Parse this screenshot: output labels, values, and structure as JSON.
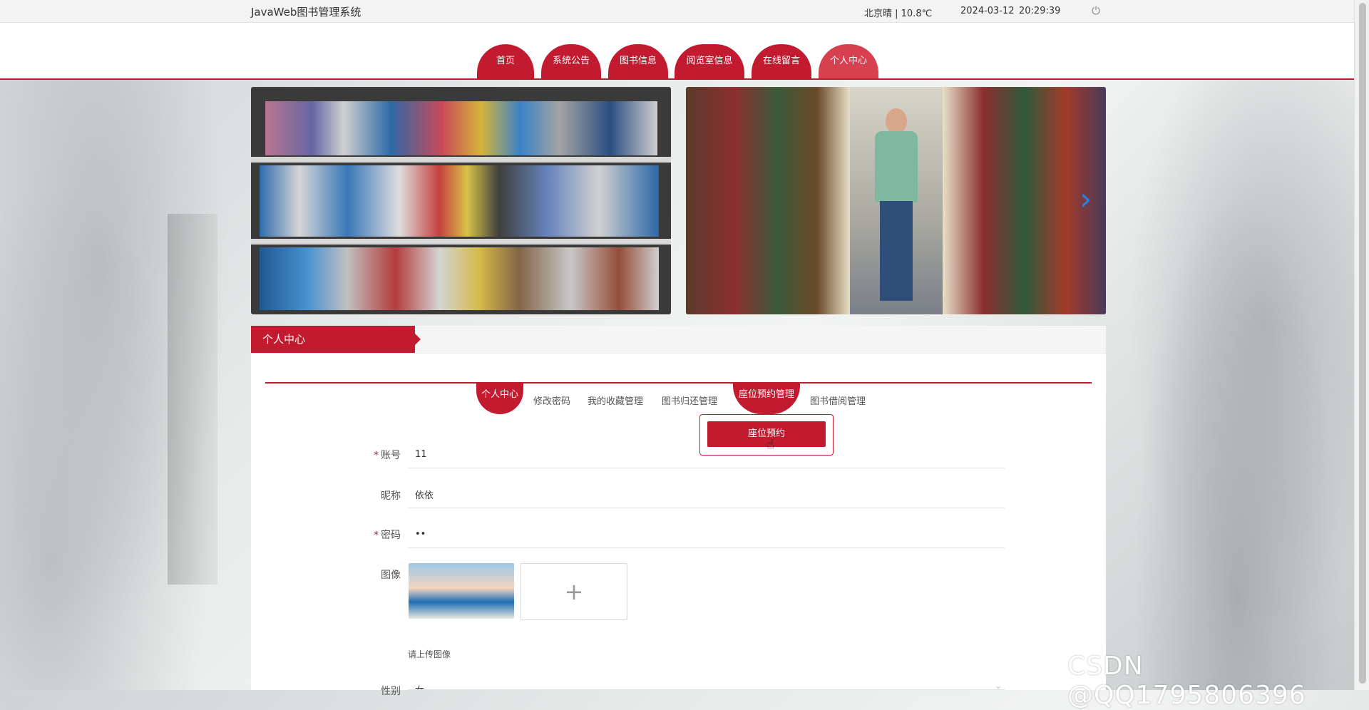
{
  "topbar": {
    "site_title": "JavaWeb图书管理系统",
    "weather": "北京晴 | 10.8℃",
    "date": "2024-03-12",
    "time": "20:29:39",
    "power_icon": "power-icon"
  },
  "nav": {
    "items": [
      {
        "label": "首页"
      },
      {
        "label": "系统公告"
      },
      {
        "label": "图书信息"
      },
      {
        "label": "阅览室信息"
      },
      {
        "label": "在线留言"
      },
      {
        "label": "个人中心"
      }
    ],
    "active": "个人中心"
  },
  "carousel": {
    "next_icon": "chevron-right-icon"
  },
  "panel": {
    "title": "个人中心",
    "sub_tabs": [
      {
        "label": "个人中心"
      },
      {
        "label": "修改密码"
      },
      {
        "label": "我的收藏管理"
      },
      {
        "label": "图书归还管理"
      },
      {
        "label": "座位预约管理"
      },
      {
        "label": "图书借阅管理"
      }
    ],
    "dropdown": {
      "item": "座位预约"
    }
  },
  "form": {
    "account": {
      "label": "账号",
      "value": "11",
      "required": true
    },
    "nickname": {
      "label": "昵称",
      "value": "依依",
      "required": false
    },
    "password": {
      "label": "密码",
      "value": "••",
      "required": true
    },
    "avatar": {
      "label": "图像",
      "hint": "请上传图像"
    },
    "gender": {
      "label": "性别",
      "value": "女"
    }
  },
  "watermark": "CSDN @QQ1795806396",
  "colors": {
    "primary": "#c21b30",
    "active_tab": "#d6404f"
  }
}
